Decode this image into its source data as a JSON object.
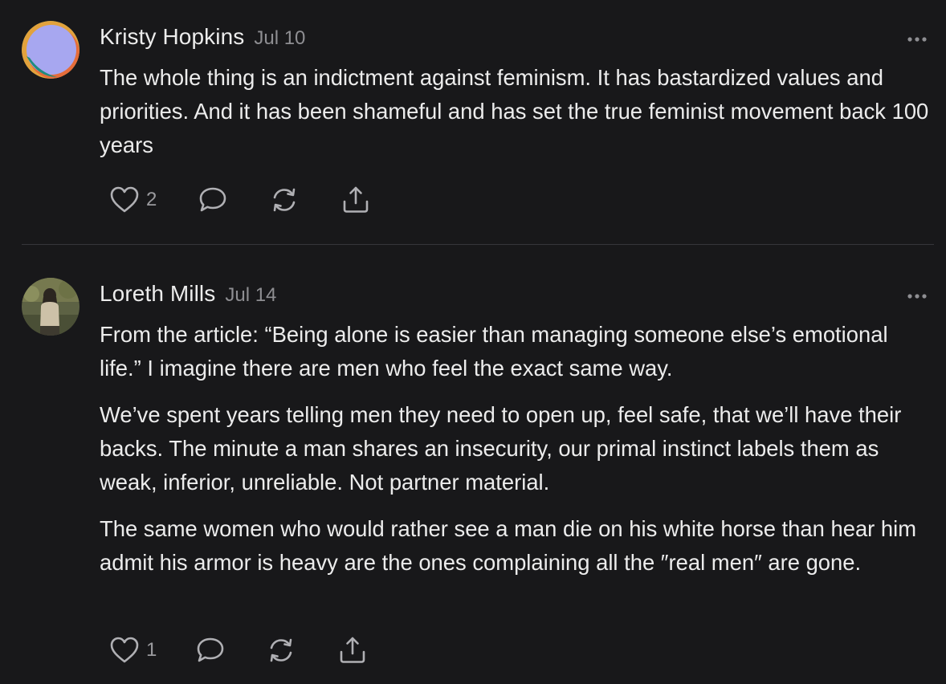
{
  "comments": [
    {
      "author": "Kristy Hopkins",
      "date": "Jul 10",
      "paragraphs": [
        "The whole thing is an indictment against feminism. It has bastardized values and priorities. And it has been shameful and has set the true feminist movement back 100 years"
      ],
      "likes": "2",
      "avatar_icon": "abstract-shapes-avatar"
    },
    {
      "author": "Loreth Mills",
      "date": "Jul 14",
      "paragraphs": [
        "From the article: “Being alone is easier than managing someone else’s emotional life.” I imagine there are men who feel the exact same way.",
        "We’ve spent years telling men they need to open up, feel safe, that we’ll have their backs. The minute a man shares an insecurity, our primal instinct labels them as weak, inferior, unreliable. Not partner material.",
        "The same women who would rather see a man die on his white horse than hear him admit his armor is heavy are the ones complaining all the ″real men″ are gone."
      ],
      "likes": "1",
      "avatar_icon": "photo-avatar"
    }
  ],
  "icons": {
    "like": "heart-icon",
    "reply": "speech-bubble-icon",
    "restack": "restack-arrows-icon",
    "share": "share-upload-icon",
    "more": "ellipsis-icon"
  },
  "colors": {
    "background": "#18181a",
    "text": "#ececec",
    "muted": "#8e8e92",
    "icon": "#b0b0b4",
    "divider": "#36363a"
  }
}
